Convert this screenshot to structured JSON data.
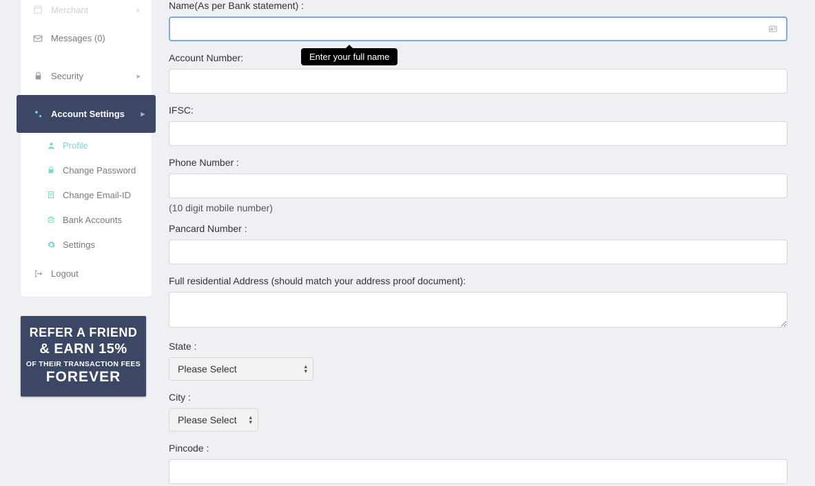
{
  "sidebar": {
    "merchant": "Merchant",
    "messages": "Messages (0)",
    "security": "Security",
    "account_settings": "Account Settings",
    "sub": {
      "profile": "Profile",
      "change_password": "Change Password",
      "change_email": "Change Email-ID",
      "bank_accounts": "Bank Accounts",
      "settings": "Settings"
    },
    "logout": "Logout"
  },
  "promo": {
    "line1": "REFER A FRIEND",
    "line2": "& EARN 15%",
    "line3": "OF THEIR TRANSACTION FEES",
    "line4": "FOREVER"
  },
  "form": {
    "name_label": "Name(As per Bank statement) :",
    "name_value": "",
    "account_label": "Account Number:",
    "account_value": "",
    "ifsc_label": "IFSC:",
    "ifsc_value": "",
    "phone_label": "Phone Number :",
    "phone_value": "",
    "phone_helper": "(10 digit mobile number)",
    "pan_label": "Pancard Number :",
    "pan_value": "",
    "address_label": "Full residential Address (should match your address proof document):",
    "address_value": "",
    "state_label": "State :",
    "state_placeholder": "Please Select",
    "city_label": "City :",
    "city_placeholder": "Please Select",
    "pincode_label": "Pincode :",
    "pincode_value": ""
  },
  "tooltip": "Enter your full name"
}
